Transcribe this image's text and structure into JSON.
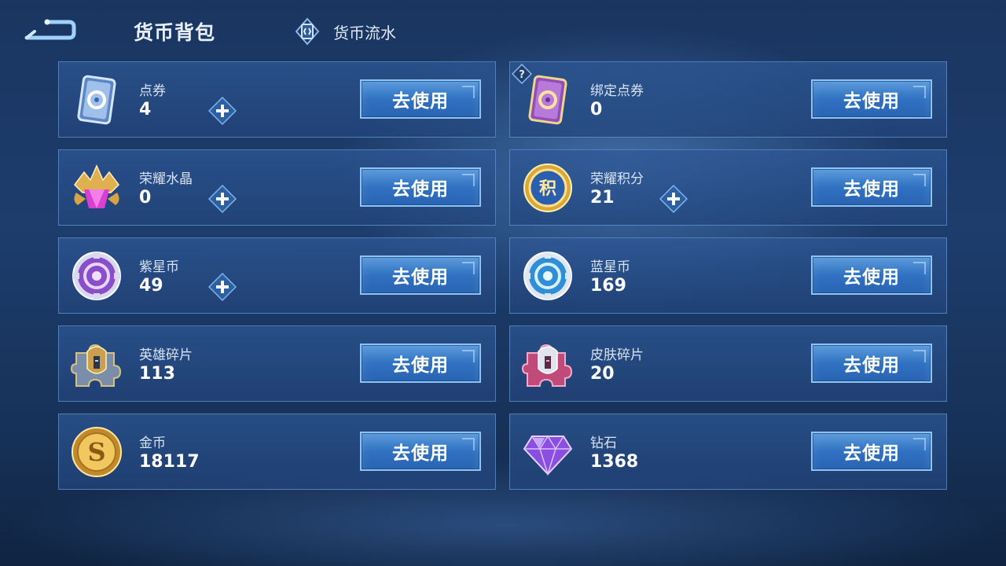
{
  "header": {
    "title": "货币背包",
    "flow_link_label": "货币流水"
  },
  "colors": {
    "background": "#1d3d6d",
    "card": "#2c5a96",
    "button": "#3a7ccb",
    "button_border": "#8cc4f5"
  },
  "currencies": [
    {
      "name": "点券",
      "amount": "4",
      "button": "去使用",
      "icon": "voucher-blue-icon",
      "has_plus": true
    },
    {
      "name": "绑定点券",
      "amount": "0",
      "button": "去使用",
      "icon": "voucher-purple-icon",
      "has_plus": false,
      "has_help": true
    },
    {
      "name": "荣耀水晶",
      "amount": "0",
      "button": "去使用",
      "icon": "glory-crystal-icon",
      "has_plus": true
    },
    {
      "name": "荣耀积分",
      "amount": "21",
      "button": "去使用",
      "icon": "glory-points-icon",
      "has_plus": true
    },
    {
      "name": "紫星币",
      "amount": "49",
      "button": "去使用",
      "icon": "purple-star-coin-icon",
      "has_plus": true
    },
    {
      "name": "蓝星币",
      "amount": "169",
      "button": "去使用",
      "icon": "blue-star-coin-icon",
      "has_plus": false
    },
    {
      "name": "英雄碎片",
      "amount": "113",
      "button": "去使用",
      "icon": "hero-fragment-icon",
      "has_plus": false
    },
    {
      "name": "皮肤碎片",
      "amount": "20",
      "button": "去使用",
      "icon": "skin-fragment-icon",
      "has_plus": false
    },
    {
      "name": "金币",
      "amount": "18117",
      "button": "去使用",
      "icon": "gold-coin-icon",
      "has_plus": false
    },
    {
      "name": "钻石",
      "amount": "1368",
      "button": "去使用",
      "icon": "diamond-icon",
      "has_plus": false
    }
  ]
}
